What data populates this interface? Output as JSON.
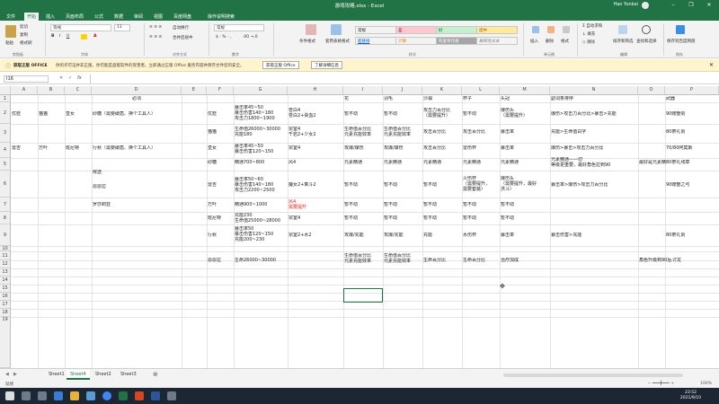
{
  "window": {
    "title": "游戏攻略.xlsx  -  Excel",
    "user": "Hao Yunkai"
  },
  "ribbon_tabs": [
    "文件",
    "开始",
    "插入",
    "页面布局",
    "公式",
    "数据",
    "审阅",
    "视图",
    "百度网盘",
    "操作说明搜索"
  ],
  "ribbon": {
    "paste": "粘贴",
    "cut": "剪切",
    "copy": "复制",
    "format_painter": "格式刷",
    "font_name": "等线",
    "font_size": "11",
    "wrap_text": "自动换行",
    "merge_center": "合并后居中",
    "number_format": "常规",
    "conditional_format": "条件格式",
    "format_as_table": "套用表格格式",
    "styles": [
      {
        "label": "常规",
        "bg": "#ffffff",
        "fg": "#222222"
      },
      {
        "label": "差",
        "bg": "#ffc7ce",
        "fg": "#9c0006"
      },
      {
        "label": "好",
        "bg": "#c6efce",
        "fg": "#006100"
      },
      {
        "label": "适中",
        "bg": "#ffeb9c",
        "fg": "#9c5700"
      },
      {
        "label": "超链接",
        "bg": "#ffffff",
        "fg": "#0563c1"
      },
      {
        "label": "计算",
        "bg": "#f2f2f2",
        "fg": "#fa7d00"
      },
      {
        "label": "检查单元格",
        "bg": "#a5a5a5",
        "fg": "#ffffff"
      },
      {
        "label": "解释性文本",
        "bg": "#ffffff",
        "fg": "#7f7f7f"
      }
    ],
    "insert": "插入",
    "delete": "删除",
    "format": "格式",
    "autosum": "自动求和",
    "fill": "填充",
    "clear": "清除",
    "sort_filter": "排序和筛选",
    "find_select": "查找和选择",
    "save_to_baidu": "保存到百度网盘",
    "groups": [
      "剪贴板",
      "字体",
      "对齐方式",
      "数字",
      "样式",
      "单元格",
      "编辑",
      "保存"
    ]
  },
  "message_bar": {
    "title": "获取正版 OFFICE",
    "text": "你的许可证并非正版，你可能是盗版软件的受害者。立即通过正版 Office 服务内容并保存文件您的安全。",
    "btn1": "获取正版 Office",
    "btn2": "了解详细信息"
  },
  "formula_bar": {
    "name_box": "I16",
    "fx": "fx",
    "value": ""
  },
  "columns": [
    "A",
    "B",
    "C",
    "D",
    "E",
    "F",
    "G",
    "H",
    "I",
    "J",
    "K",
    "L",
    "M",
    "N",
    "O",
    "P"
  ],
  "rows": [
    "1",
    "2",
    "3",
    "4",
    "5",
    "6",
    "7",
    "8",
    "9",
    "10",
    "11",
    "12",
    "13",
    "14",
    "15",
    "16",
    "17",
    "18",
    "19"
  ],
  "cells": {
    "d1": "必须",
    "a2": "优菈",
    "b2": "猫猫",
    "c2": "皇女",
    "d2": "砂糖（需要破盾、换个工具人）",
    "a4": "雷吉",
    "b4": "万叶",
    "c4": "班尼特",
    "d4": "行秋（需要破盾、换个工具人）",
    "d5": "候选",
    "d6": "恩恩拉",
    "d7": "罗莎莉亚",
    "i1": "花",
    "j1": "羽毛",
    "k1": "沙漏",
    "l1": "杯子",
    "m1": "头冠",
    "n1": "副词条排序",
    "p1": "武器",
    "f2": "优菈",
    "g2": "暴击率45~50\n暴击伤害140~180\n攻击力1800~1900",
    "h2": "苍白4\n苍白2+染血2",
    "i2": "暂不动",
    "j2": "暂不动",
    "k2": "攻击力百分比\n（需要提升）",
    "l2": "暂不动",
    "m2": "爆伤头\n（需要提升）",
    "n2": "爆伤>攻击力百分比>暴击>充能",
    "p2": "90螃蟹剑",
    "f3": "猫猫",
    "g3": "生命值26000~30000\n充能180",
    "h3": "宗室4\n千岩2+少女2",
    "i3": "生命值百分比\n元素充能效率",
    "j3": "生命值百分比\n元素充能效率",
    "k3": "攻击百分比",
    "l3": "攻击百分比",
    "m3": "暴击率",
    "n3": "充能>生命值白字",
    "p3": "80祭礼剑",
    "f4": "皇女",
    "g4": "暴击率45~50\n暴击伤害120~150",
    "h4": "宗室4",
    "i4": "攻爆/爆伤",
    "j4": "攻爆/爆伤",
    "k4": "攻击百分比",
    "l4": "雷伤杯",
    "m4": "暴击率",
    "n4": "爆伤>暴击>攻击力百分比",
    "p4": "70/80阿莫斯",
    "f5": "砂糖",
    "g5": "精通700~800",
    "h5": "风4",
    "i5": "元素精通",
    "j5": "元素精通",
    "k5": "元素精通",
    "l5": "元素精通",
    "m5": "元素精通",
    "n5": "元素精通——切\n等级更重要，最好角色拉到90",
    "o5": "最好是元素精通",
    "p5": "80祭礼残章",
    "f6": "雷吉",
    "g6": "暴击率50~60\n暴击伤害140~180\n攻击力2200~2500",
    "h6": "魔女2+乘斗2",
    "i6": "暂不动",
    "j6": "暂不动",
    "k6": "暂不动",
    "l6": "火伤杯\n（需要提升，\n需要套装）",
    "m6": "爆伤头\n（需要提升，最好\n洪斗）",
    "n6": "暴击率>爆伤>攻击力百分比",
    "p6": "90螃蟹之弓",
    "f7": "万叶",
    "g7": "精通900~1000",
    "h7": "风4\n需要提升",
    "i7": "暂不动",
    "j7": "暂不动",
    "k7": "暂不动",
    "l7": "暂不动",
    "m7": "暂不动",
    "f8": "班尼特",
    "g8": "充能230\n生命值25000~28000",
    "h8": "宗室4",
    "i8": "暂不动",
    "j8": "暂不动",
    "k8": "暂不动",
    "l8": "暂不动",
    "m8": "暂不动",
    "f9": "行秋",
    "g9": "暴击率50\n暴击伤害120~150\n充能200~230",
    "h9": "宗室2+水2",
    "i9": "攻爆/充能",
    "j9": "攻爆/充能",
    "k9": "充能",
    "l9": "水伤杯",
    "m9": "暴击率",
    "n9": "暴击伤害>充能",
    "p9": "80祭礼剑",
    "f10": "恩恩拉",
    "g10": "生命26000~30000",
    "i10": "生命值百分比\n元素充能效率",
    "j10": "生命值百分比\n元素充能效率",
    "k10": "生命百分比",
    "l10": "生命百分比",
    "m10": "治疗加成",
    "o10": "角色升级到90后",
    "p10": "讨龙"
  },
  "sheets": [
    "Sheet1",
    "Sheet4",
    "Sheet2",
    "Sheet3"
  ],
  "active_sheet": "Sheet4",
  "status": {
    "ready": "就绪",
    "zoom": "100%"
  },
  "taskbar": {
    "time": "23:52",
    "date": "2021/9/10"
  }
}
